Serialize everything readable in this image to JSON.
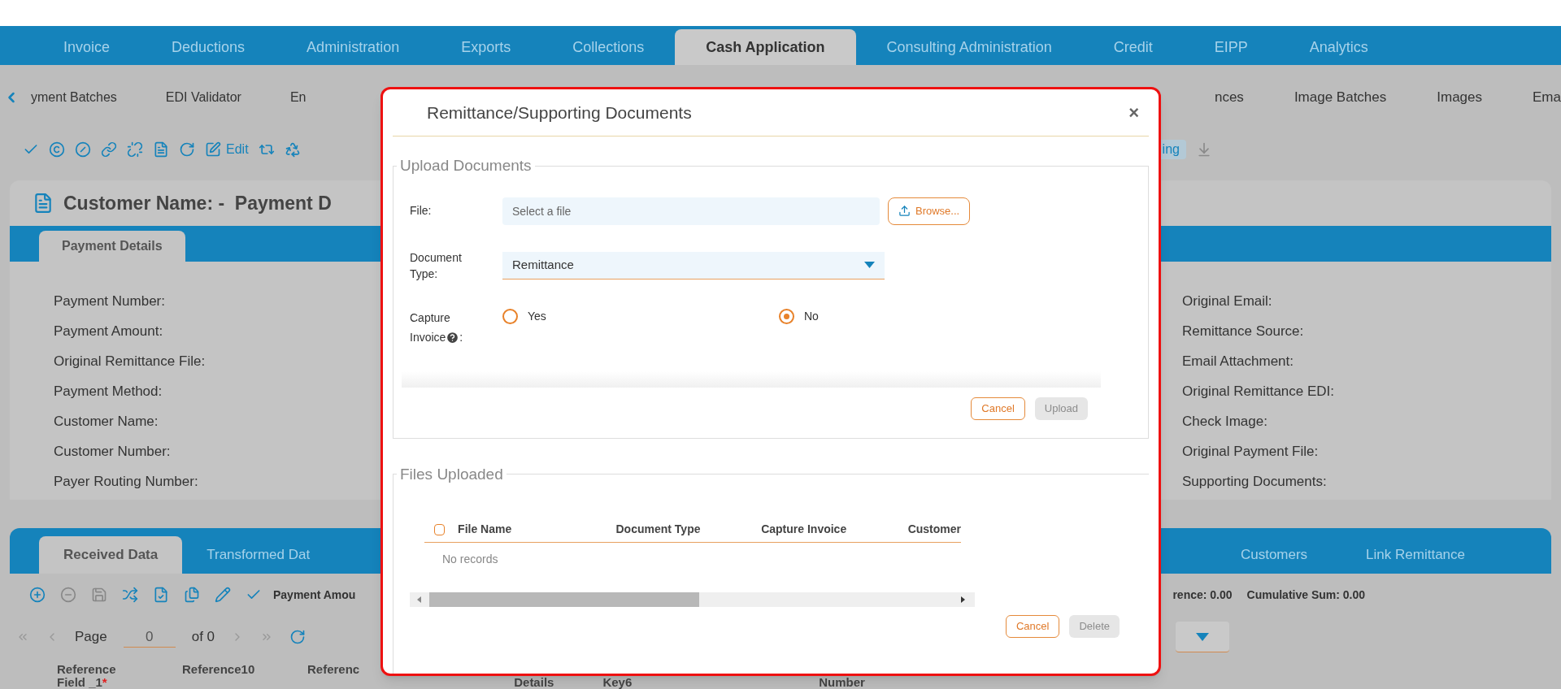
{
  "main_nav": [
    {
      "label": "Invoice",
      "selected": false
    },
    {
      "label": "Deductions",
      "selected": false
    },
    {
      "label": "Administration",
      "selected": false
    },
    {
      "label": "Exports",
      "selected": false
    },
    {
      "label": "Collections",
      "selected": false
    },
    {
      "label": "Cash Application",
      "selected": true
    },
    {
      "label": "Consulting Administration",
      "selected": false
    },
    {
      "label": "Credit",
      "selected": false
    },
    {
      "label": "EIPP",
      "selected": false
    },
    {
      "label": "Analytics",
      "selected": false
    }
  ],
  "sub_nav_left": [
    "yment Batches",
    "EDI Validator",
    "En"
  ],
  "sub_nav_right": [
    "nces",
    "Image Batches",
    "Images",
    "Ema"
  ],
  "toolbar": {
    "edit_label": "Edit",
    "right_label": "ing"
  },
  "page_title": "Customer Name: -  Payment D",
  "detail_tabs": [
    {
      "label": "Payment Details",
      "selected": true
    }
  ],
  "fields_left": [
    "Payment Number:",
    "Payment Amount:",
    "Original Remittance File:",
    "Payment Method:",
    "Customer Name:",
    "Customer Number:",
    "Payer Routing Number:"
  ],
  "fields_right": [
    "Original Email:",
    "Remittance Source:",
    "Email Attachment:",
    "Original Remittance EDI:",
    "Check Image:",
    "Original Payment File:",
    "Supporting Documents:"
  ],
  "data_tabs_left": [
    {
      "label": "Received Data",
      "selected": true
    },
    {
      "label": "Transformed Dat",
      "selected": false
    }
  ],
  "data_tabs_right": [
    {
      "label": "Customers",
      "selected": false
    },
    {
      "label": "Link Remittance",
      "selected": false
    }
  ],
  "grid_toolbar": {
    "left_label": "Payment Amou",
    "difference": "rence: 0.00",
    "cumulative": "Cumulative Sum: 0.00"
  },
  "pager": {
    "page_label": "Page",
    "page_value": "0",
    "of_label": "of 0"
  },
  "columns": [
    "Reference Field _1*",
    "Reference10",
    "Referenc",
    "Details",
    "Key6",
    "Number"
  ],
  "modal": {
    "title": "Remittance/Supporting Documents",
    "close": "×",
    "upload": {
      "legend": "Upload Documents",
      "file_label": "File:",
      "file_placeholder": "Select a file",
      "browse": "Browse...",
      "doctype_label": "Document Type:",
      "doctype_value": "Remittance",
      "capture_label": "Capture Invoice",
      "capture_colon": ":",
      "options": [
        {
          "label": "Yes",
          "selected": false
        },
        {
          "label": "No",
          "selected": true
        }
      ],
      "cancel": "Cancel",
      "upload": "Upload",
      "upload_disabled": true
    },
    "files": {
      "legend": "Files Uploaded",
      "columns": [
        "File Name",
        "Document Type",
        "Capture Invoice",
        "Customer"
      ],
      "select_all_checked": false,
      "empty": "No records",
      "cancel": "Cancel",
      "delete": "Delete",
      "delete_disabled": true
    }
  }
}
